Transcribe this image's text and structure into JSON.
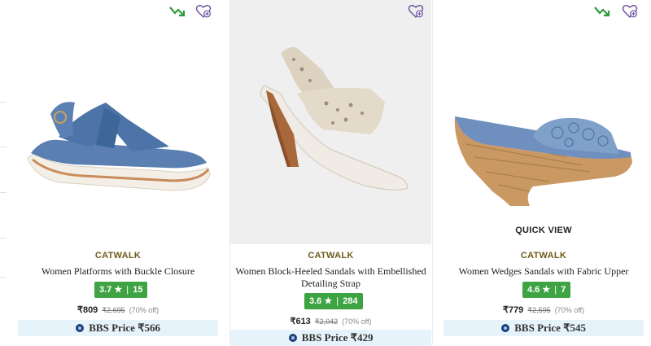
{
  "products": [
    {
      "brand": "CATWALK",
      "title": "Women Platforms with Buckle Closure",
      "rating": "3.7",
      "rating_star": "★",
      "rating_sep": "|",
      "reviews": "15",
      "price": "₹809",
      "mrp": "₹2,695",
      "discount": "(70% off)",
      "bbs_label": "BBS Price",
      "bbs_price": "₹566",
      "trending": true
    },
    {
      "brand": "CATWALK",
      "title": "Women Block-Heeled Sandals with Embellished Detailing Strap",
      "rating": "3.6",
      "rating_star": "★",
      "rating_sep": "|",
      "reviews": "284",
      "price": "₹613",
      "mrp": "₹2,042",
      "discount": "(70% off)",
      "bbs_label": "BBS Price",
      "bbs_price": "₹429",
      "trending": false
    },
    {
      "brand": "CATWALK",
      "title": "Women Wedges Sandals with Fabric Upper",
      "rating": "4.6",
      "rating_star": "★",
      "rating_sep": "|",
      "reviews": "7",
      "price": "₹779",
      "mrp": "₹2,595",
      "discount": "(70% off)",
      "bbs_label": "BBS Price",
      "bbs_price": "₹545",
      "trending": true,
      "quick_view": "QUICK VIEW"
    }
  ],
  "colors": {
    "rating_green": "#3ea342",
    "brand_gold": "#6f5b1a",
    "bbs_bg": "#e6f3fa",
    "trend_green": "#2e9a3c",
    "wishlist_purple": "#6a4f9e"
  },
  "icons": [
    "trending-down-icon",
    "wishlist-heart-icon",
    "bbs-coin-icon"
  ]
}
